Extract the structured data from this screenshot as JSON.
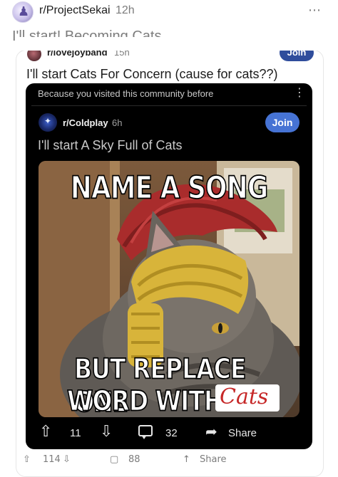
{
  "outer_post": {
    "subreddit": "r/ProjectSekai",
    "time": "12h",
    "more_icon": "⋯",
    "title": "I'll start! Becoming Cats"
  },
  "crosspost": {
    "subreddit": "r/lovejoyband",
    "time": "15h",
    "join_label": "Join",
    "title": "I'll start Cats For Concern (cause for cats??)"
  },
  "embedded_post": {
    "recommendation": "Because you visited this community before",
    "subreddit": "r/Coldplay",
    "time": "6h",
    "join_label": "Join",
    "title": "I'll start A Sky Full of Cats",
    "meme": {
      "top_text": "NAME A SONG",
      "bottom_line1": "BUT REPLACE ONE",
      "bottom_line2": "WORD WITH",
      "cats_word": "Cats"
    },
    "actions": {
      "votes": "11",
      "comments": "32",
      "share": "Share"
    }
  },
  "outer_actions": {
    "votes": "114",
    "comments": "88",
    "share": "Share"
  },
  "colors": {
    "join_dark_bg": "#4673d4",
    "join_light_bg": "#2f4d9c",
    "dark_card_bg": "#000000",
    "cats_text": "#c62828"
  }
}
